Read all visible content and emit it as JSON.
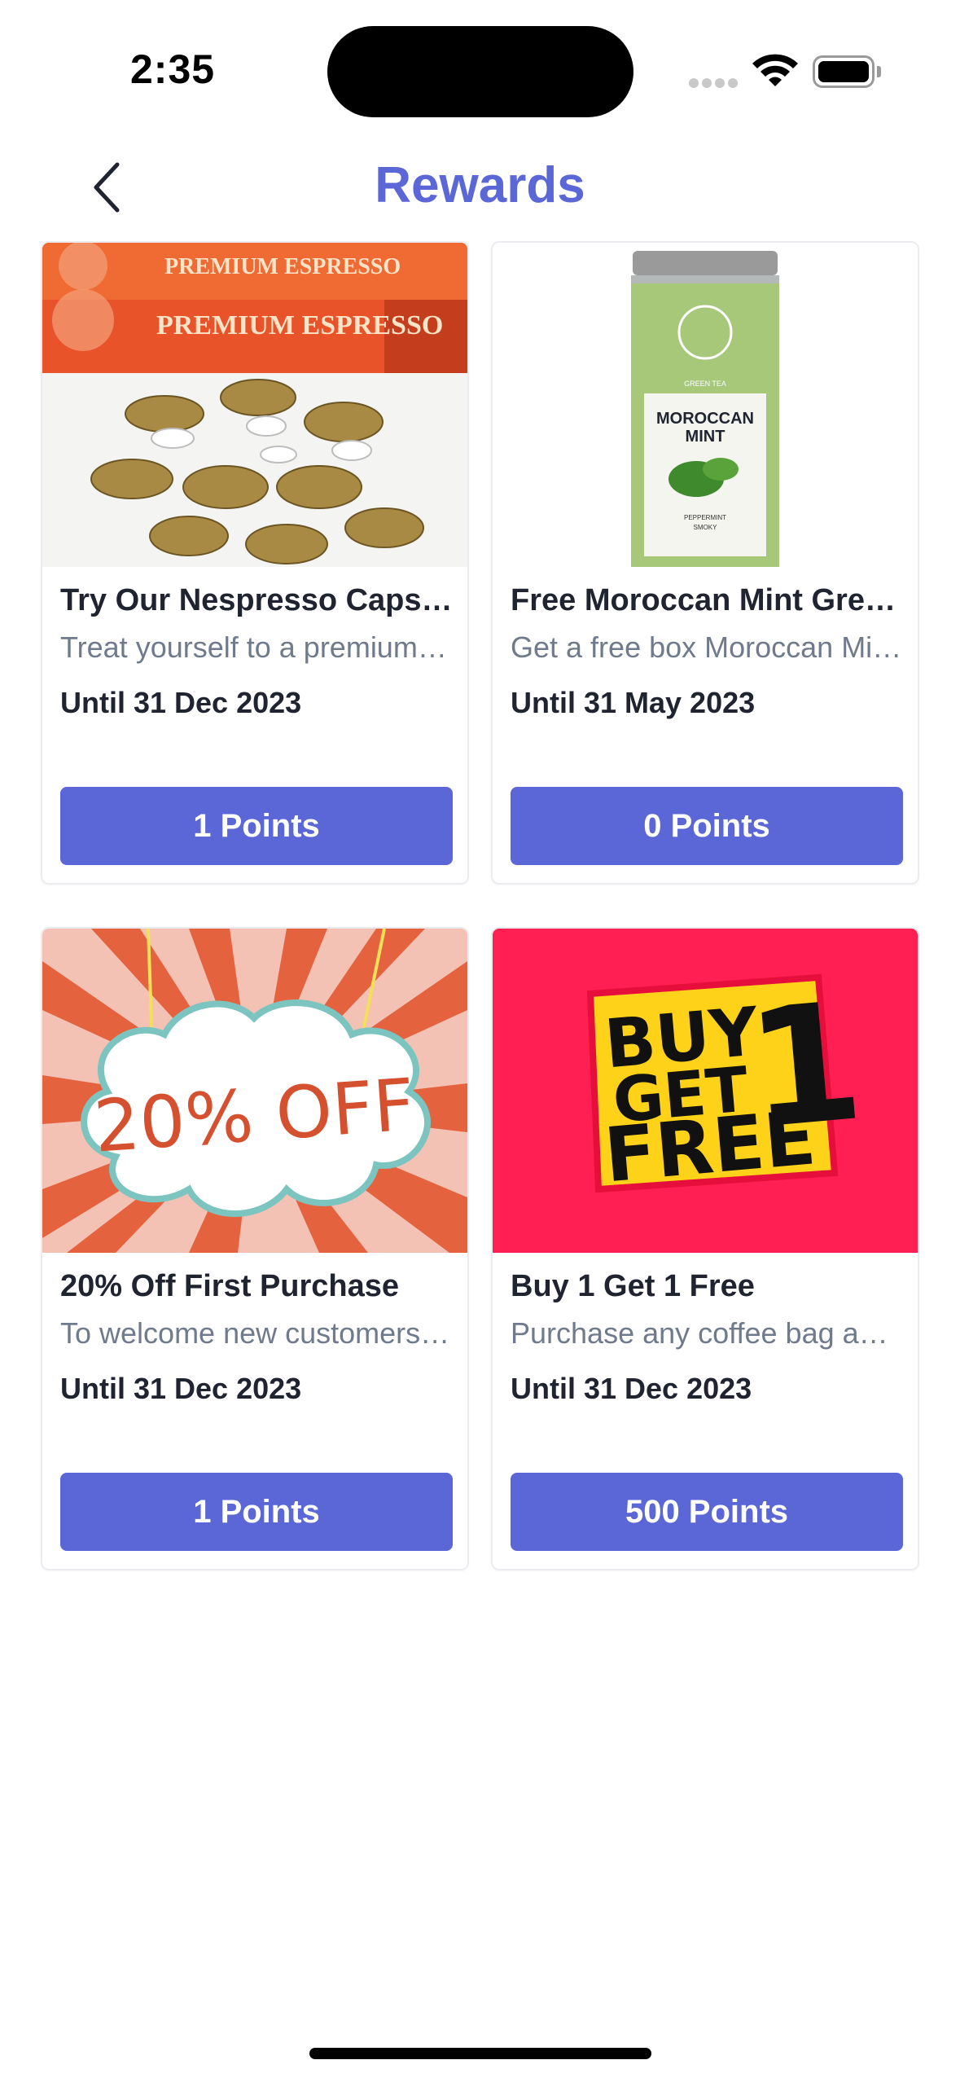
{
  "status_bar": {
    "time": "2:35"
  },
  "nav": {
    "title": "Rewards",
    "accent": "#5b67d6"
  },
  "rewards": [
    {
      "title": "Try Our Nespresso Capsules",
      "description": "Treat yourself to a premium coffee experience",
      "date": "Until 31 Dec 2023",
      "points": "1 Points",
      "image": "nespresso-capsules",
      "image_texts": [
        "PREMIUM ESPRESSO",
        "PREMIUM ESPRESSO"
      ]
    },
    {
      "title": "Free Moroccan Mint Green Tea",
      "description": "Get a free box Moroccan Mint Green Tea",
      "date": "Until 31 May 2023",
      "points": "0 Points",
      "image": "moroccan-mint-tin",
      "image_texts": [
        "MOROCCAN",
        "MINT",
        "GREEN TEA",
        "PEPPERMINT",
        "SMOKY"
      ]
    },
    {
      "title": "20% Off First Purchase",
      "description": "To welcome new customers to our store",
      "date": "Until 31 Dec 2023",
      "points": "1 Points",
      "image": "twenty-off-sign",
      "image_texts": [
        "20% OFF"
      ]
    },
    {
      "title": "Buy 1 Get 1 Free",
      "description": "Purchase any coffee bag and get another free",
      "date": "Until 31 Dec 2023",
      "points": "500 Points",
      "image": "buy-one-get-one-sign",
      "image_texts": [
        "BUY",
        "GET",
        "FREE",
        "1"
      ]
    }
  ]
}
